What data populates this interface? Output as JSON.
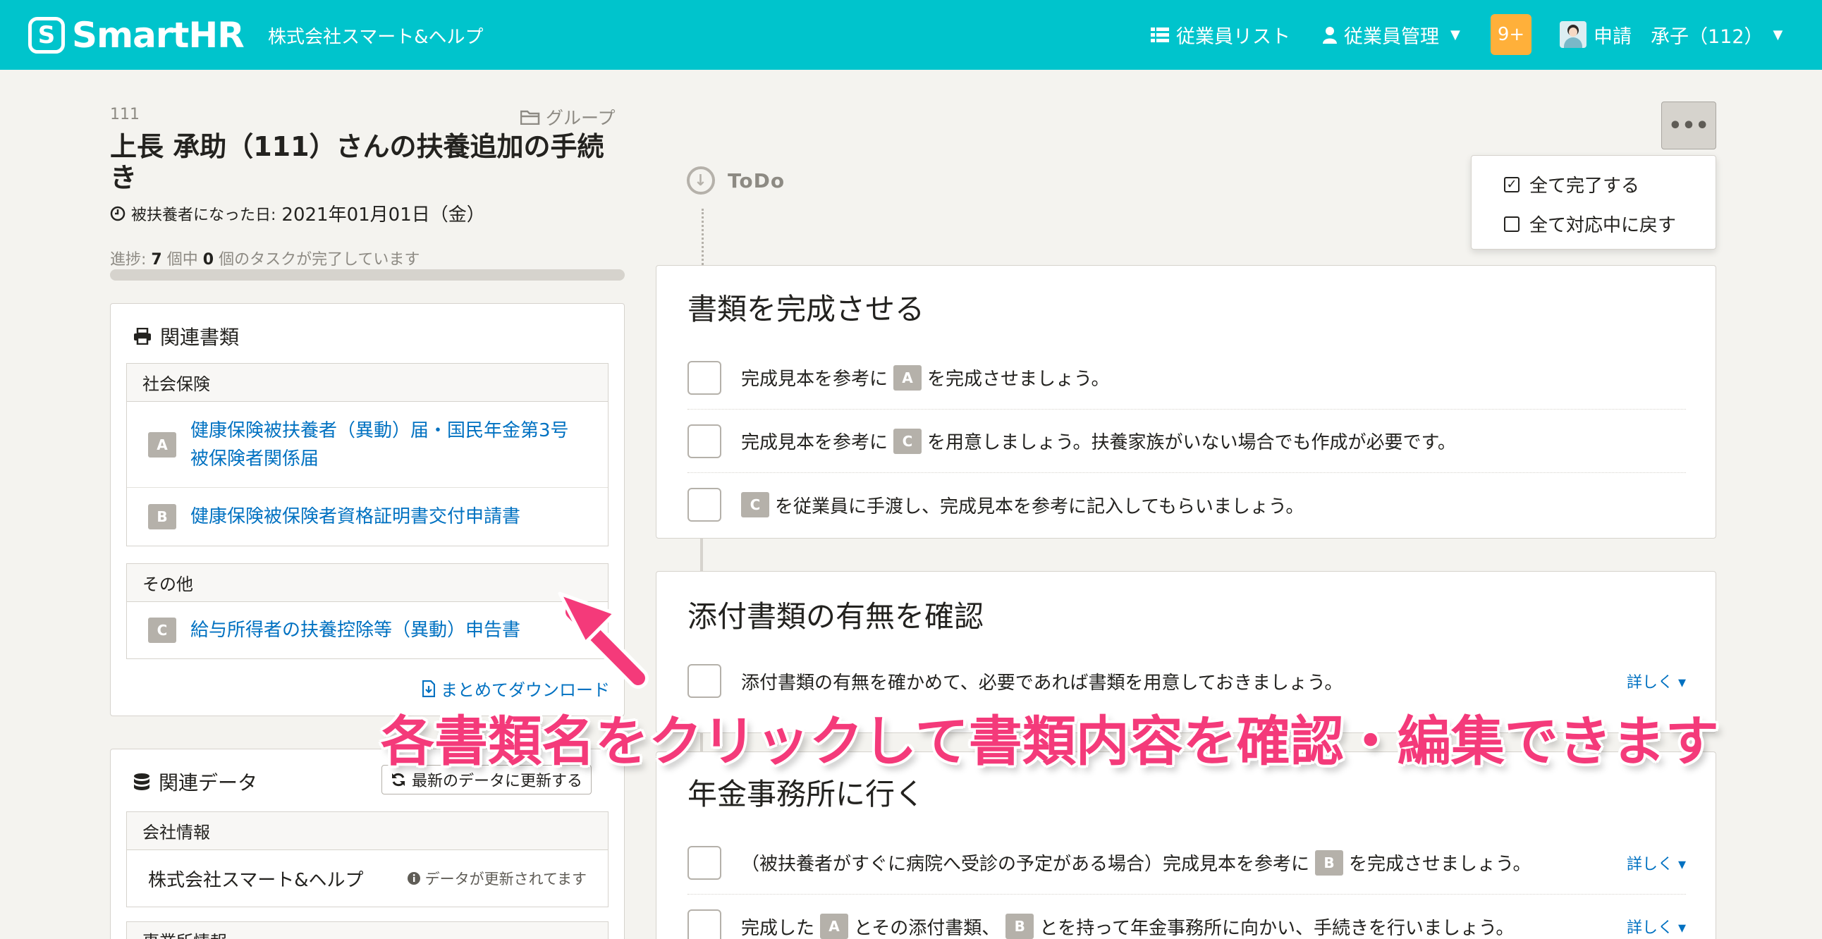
{
  "header": {
    "logo_text": "SmartHR",
    "company": "株式会社スマート&ヘルプ",
    "nav_employees": "従業員リスト",
    "nav_manage": "従業員管理",
    "notifications": "9+",
    "user_label": "申請　承子（112）",
    "colors": {
      "bar": "#00c4cc",
      "notif": "#ffb03a"
    }
  },
  "procedure": {
    "id": "111",
    "group_label": "グループ",
    "title": "上長 承助（111）さんの扶養追加の手続き",
    "date_label": "被扶養者になった日:",
    "date_value": "2021年01月01日（金）",
    "progress_prefix": "進捗:",
    "progress_total": "7",
    "progress_mid": "個中",
    "progress_done": "0",
    "progress_suffix": "個のタスクが完了しています",
    "progress_fraction": 0
  },
  "docs": {
    "heading": "関連書類",
    "groups": [
      {
        "name": "社会保険",
        "items": [
          {
            "badge": "A",
            "label": "健康保険被扶養者（異動）届・国民年金第3号被保険者関係届"
          },
          {
            "badge": "B",
            "label": "健康保険被保険者資格証明書交付申請書"
          }
        ]
      },
      {
        "name": "その他",
        "items": [
          {
            "badge": "C",
            "label": "給与所得者の扶養控除等（異動）申告書"
          }
        ]
      }
    ],
    "download": "まとめてダウンロード"
  },
  "related_data": {
    "heading": "関連データ",
    "refresh": "最新のデータに更新する",
    "company_group": "会社情報",
    "company_value": "株式会社スマート&ヘルプ",
    "updated_note": "データが更新されてます",
    "next_group": "事業所情報"
  },
  "timeline": {
    "todo_label": "ToDo",
    "more_button": "•••",
    "menu": {
      "complete_all": "全て完了する",
      "reset_all": "全て対応中に戻す"
    }
  },
  "tasks": [
    {
      "title": "書類を完成させる",
      "items": [
        {
          "pre": "完成見本を参考に",
          "badge": "A",
          "post": "を完成させましょう。"
        },
        {
          "pre": "完成見本を参考に",
          "badge": "C",
          "post": "を用意しましょう。扶養家族がいない場合でも作成が必要です。"
        },
        {
          "pre": "",
          "badge": "C",
          "post": "を従業員に手渡し、完成見本を参考に記入してもらいましょう。"
        }
      ]
    },
    {
      "title": "添付書類の有無を確認",
      "items": [
        {
          "text": "添付書類の有無を確かめて、必要であれば書類を用意しておきましょう。",
          "more": "詳しく ▾"
        }
      ]
    },
    {
      "title": "年金事務所に行く",
      "items": [
        {
          "pre": "（被扶養者がすぐに病院へ受診の予定がある場合）完成見本を参考に",
          "badge": "B",
          "post": "を完成させましょう。",
          "more": "詳しく ▾"
        },
        {
          "pre": "完成した",
          "badge": "A",
          "mid": "とその添付書類、",
          "badge2": "B",
          "post": "とを持って年金事務所に向かい、手続きを行いましょう。",
          "more": "詳しく ▾"
        }
      ]
    }
  ],
  "annotation": {
    "text": "各書類名をクリックして書類内容を確認・編集できます",
    "color": "#f43a7a"
  }
}
